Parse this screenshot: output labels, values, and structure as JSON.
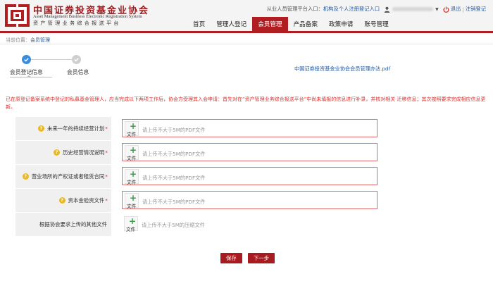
{
  "header": {
    "brand_cn": "中国证券投资基金业协会",
    "brand_en": "Asset Management Business Electronic Registration System",
    "brand_sub": "资产管理业务综合报送平台",
    "entry_text": "从业人员管理平台入口：",
    "entry_link": "机构及个人注册登记入口",
    "logout": "退出",
    "separator": "|",
    "cancel_account": "注销登记"
  },
  "nav": {
    "items": [
      {
        "label": "首页",
        "active": false
      },
      {
        "label": "管理人登记",
        "active": false
      },
      {
        "label": "会员管理",
        "active": true
      },
      {
        "label": "产品备案",
        "active": false
      },
      {
        "label": "政策申请",
        "active": false
      },
      {
        "label": "账号管理",
        "active": false
      }
    ]
  },
  "breadcrumb": {
    "prefix": "当前位置：",
    "current": "会员管理"
  },
  "steps": {
    "step1": "会员登记信息",
    "step2": "会员信息"
  },
  "pdf_link": "中国证券投资基金业协会会员管理办法.pdf",
  "notice": "已在原登记备案系统中登记的私募基金管理人，应当完成以下两项工作后，协会方受理其入会申请：首先对在“资产管理业务综合报送平台”中尚未填报的信息进行补录，并核对相关 迁移信息；其次按照要求完成相应信息更新。",
  "form": {
    "file_label": "文件",
    "rows": [
      {
        "label": "未来一年的持续经营计划",
        "required": "*",
        "hint": "请上传不大于5M的PDF文件"
      },
      {
        "label": "历史经营情况说明",
        "required": "*",
        "hint": "请上传不大于5M的PDF文件"
      },
      {
        "label": "营业场所的产权证或者租赁合同",
        "required": "*",
        "hint": "请上传不大于5M的PDF文件"
      },
      {
        "label": "资本金验资文件",
        "required": "*",
        "hint": "请上传不大于5M的PDF文件"
      },
      {
        "label": "根据协会要求上传的其他文件",
        "required": "",
        "hint": "请上传不大于5M的压缩文件"
      }
    ]
  },
  "buttons": {
    "save": "保存",
    "next": "下一步"
  },
  "colors": {
    "brand_red": "#b01e22",
    "link_blue": "#1f5aa6",
    "notice_red": "#d9302c",
    "step_blue": "#3c8dde",
    "plus_green": "#2ea042"
  }
}
